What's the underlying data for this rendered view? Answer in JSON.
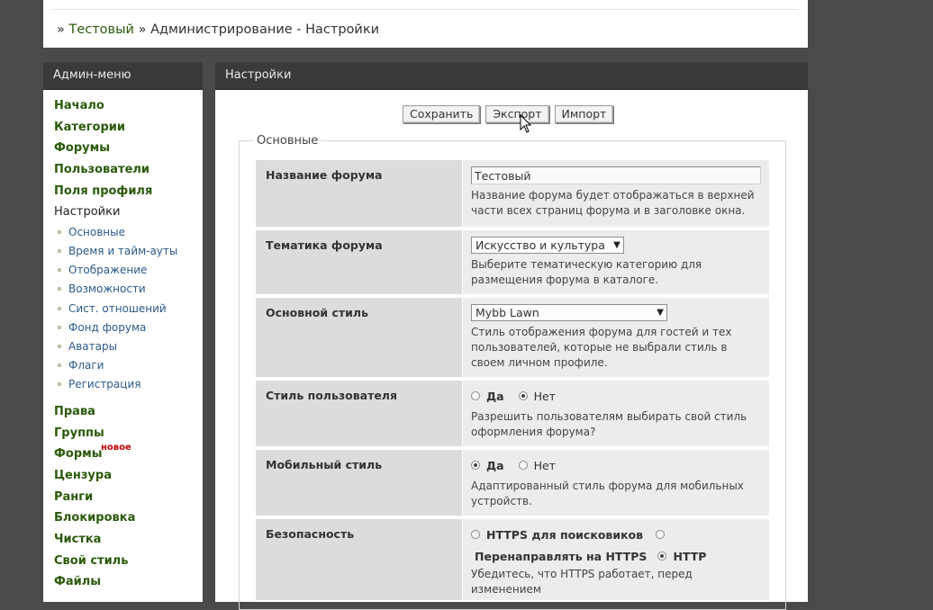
{
  "breadcrumb": {
    "sep1": "»",
    "home": "Тестовый",
    "sep2": "»",
    "current": "Администрирование - Настройки"
  },
  "sidebar": {
    "title": "Админ-меню",
    "items_top": [
      {
        "label": "Начало",
        "slug": "home"
      },
      {
        "label": "Категории",
        "slug": "categories"
      },
      {
        "label": "Форумы",
        "slug": "forums"
      },
      {
        "label": "Пользователи",
        "slug": "users"
      },
      {
        "label": "Поля профиля",
        "slug": "profile-fields"
      }
    ],
    "active": {
      "label": "Настройки",
      "slug": "settings"
    },
    "subitems": [
      {
        "label": "Основные",
        "slug": "basic"
      },
      {
        "label": "Время и тайм-ауты",
        "slug": "time"
      },
      {
        "label": "Отображение",
        "slug": "display"
      },
      {
        "label": "Возможности",
        "slug": "features"
      },
      {
        "label": "Сист. отношений",
        "slug": "relations"
      },
      {
        "label": "Фонд форума",
        "slug": "fund"
      },
      {
        "label": "Аватары",
        "slug": "avatars"
      },
      {
        "label": "Флаги",
        "slug": "flags"
      },
      {
        "label": "Регистрация",
        "slug": "registration"
      }
    ],
    "items_bottom": [
      {
        "label": "Права",
        "slug": "permissions"
      },
      {
        "label": "Группы",
        "slug": "groups"
      },
      {
        "label": "Формы",
        "slug": "forms",
        "badge": "новое"
      },
      {
        "label": "Цензура",
        "slug": "censorship"
      },
      {
        "label": "Ранги",
        "slug": "ranks"
      },
      {
        "label": "Блокировка",
        "slug": "bans"
      },
      {
        "label": "Чистка",
        "slug": "prune"
      },
      {
        "label": "Свой стиль",
        "slug": "custom-style"
      },
      {
        "label": "Файлы",
        "slug": "files"
      }
    ]
  },
  "main": {
    "title": "Настройки",
    "buttons": {
      "save": "Сохранить",
      "export": "Экспорт",
      "import": "Импорт"
    },
    "fieldset_legend": "Основные",
    "rows": {
      "forum_name": {
        "label": "Название форума",
        "value": "Тестовый",
        "desc": "Название форума будет отображаться в верхней части всех страниц форума и в заголовке окна."
      },
      "forum_topic": {
        "label": "Тематика форума",
        "value": "Искусство и культура",
        "desc": "Выберите тематическую категорию для размещения форума в каталоге."
      },
      "main_style": {
        "label": "Основной стиль",
        "value": "Mybb Lawn",
        "desc": "Стиль отображения форума для гостей и тех пользователей, которые не выбрали стиль в своем личном профиле."
      },
      "user_style": {
        "label": "Стиль пользователя",
        "opt_yes": "Да",
        "opt_no": "Нет",
        "selected": "Нет",
        "desc": "Разрешить пользователям выбирать свой стиль оформления форума?"
      },
      "mobile_style": {
        "label": "Мобильный стиль",
        "opt_yes": "Да",
        "opt_no": "Нет",
        "selected": "Да",
        "desc": "Адаптированный стиль форума для мобильных устройств."
      },
      "security": {
        "label": "Безопасность",
        "opt_https_search": "HTTPS для поисковиков",
        "opt_redirect": "Перенаправлять на HTTPS",
        "opt_http": "HTTP",
        "selected": "HTTP",
        "desc": "Убедитесь, что HTTPS работает, перед изменением"
      }
    }
  }
}
